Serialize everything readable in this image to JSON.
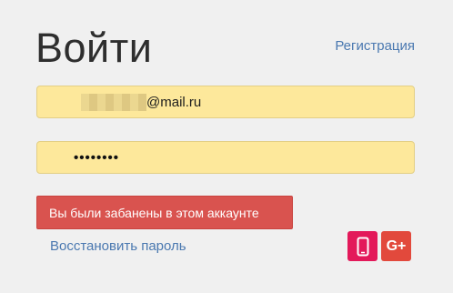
{
  "header": {
    "title": "Войти",
    "register_link": "Регистрация"
  },
  "form": {
    "email": {
      "visible_suffix": "@mail.ru",
      "local_part_obscured": true
    },
    "password": {
      "masked_value": "••••••••"
    }
  },
  "alert": {
    "message": "Вы были забанены в этом аккаунте",
    "color": "#d9534f"
  },
  "links": {
    "restore_password": "Восстановить пароль"
  },
  "social": {
    "phone": {
      "icon": "mobile-phone-icon",
      "color": "#e3195a"
    },
    "google": {
      "icon": "google-plus-icon",
      "label": "G+",
      "color": "#e2493c"
    }
  },
  "colors": {
    "background": "#f0f0f0",
    "input_autofill": "#fde89b",
    "link": "#4a78b0"
  }
}
